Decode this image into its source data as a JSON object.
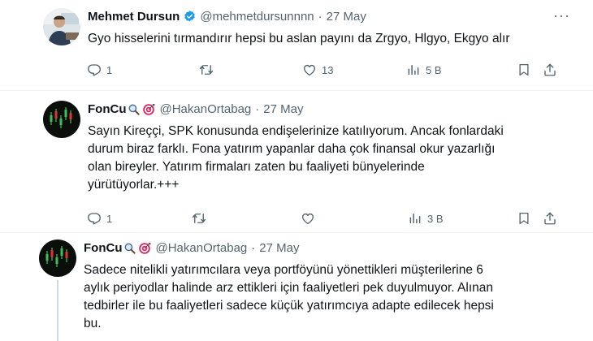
{
  "tweets": [
    {
      "name": "Mehmet Dursun",
      "handle": "@mehmetdursunnnn",
      "date": "27 May",
      "verified": true,
      "text": [
        "Gyo hisselerini tırmandırır hepsi bu aslan payını da Zrgyo, Hlgyo, Ekgyo alır"
      ],
      "replies": "1",
      "retweets": "",
      "likes": "13",
      "views": "5 B"
    },
    {
      "name": "FonCu",
      "handle": "@HakanOrtabag",
      "date": "27 May",
      "verified": false,
      "text": [
        "Sayın Kireççi, SPK konusunda endişelerinize katılıyorum. Ancak fonlardaki",
        "durum biraz farklı. Fona yatırım yapanlar daha çok finansal okur yazarlığı",
        "olan bireyler. Yatırım firmaları zaten bu faaliyeti bünyelerinde",
        "yürütüyorlar.+++"
      ],
      "replies": "1",
      "retweets": "",
      "likes": "",
      "views": "3 B"
    },
    {
      "name": "FonCu",
      "handle": "@HakanOrtabag",
      "date": "27 May",
      "verified": false,
      "text": [
        "Sadece nitelikli yatırımcılara veya portföyünü yönettikleri müşterilerine 6",
        "aylık periyodlar halinde arz ettikleri için faaliyetleri pek duyulmuyor. Alınan",
        "tedbirler ile bu faaliyetleri sadece küçük yatırımcıya adapte edilecek hepsi",
        "bu."
      ]
    }
  ],
  "colors": {
    "text": "#0f1419",
    "secondary": "#536471",
    "verified": "#1d9bf0",
    "divider": "#eff3f4"
  },
  "icons": [
    "reply-icon",
    "retweet-icon",
    "like-icon",
    "views-icon",
    "bookmark-icon",
    "share-icon",
    "verified-badge-icon",
    "magnifier-emoji-icon",
    "target-emoji-icon",
    "more-icon"
  ]
}
